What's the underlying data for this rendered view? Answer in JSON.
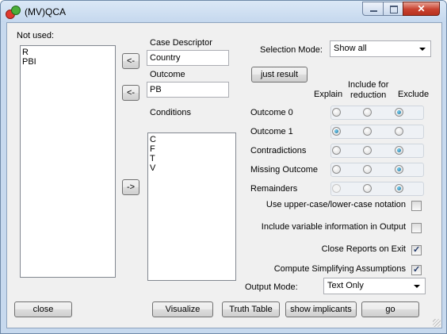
{
  "window": {
    "title": "(MV)QCA",
    "minimize_label": "minimize",
    "maximize_label": "maximize",
    "close_glyph": "✕"
  },
  "not_used": {
    "label": "Not used:",
    "items": [
      "R",
      "PBI"
    ]
  },
  "case_descriptor": {
    "label": "Case Descriptor",
    "value": "Country",
    "move_button": "<-"
  },
  "outcome": {
    "label": "Outcome",
    "value": "PB",
    "move_button": "<-"
  },
  "conditions": {
    "label": "Conditions",
    "items": [
      "C",
      "F",
      "T",
      "V"
    ],
    "move_button": "->"
  },
  "selection_mode": {
    "label": "Selection Mode:",
    "value": "Show all"
  },
  "just_result_button": "just result",
  "columns": {
    "explain": "Explain",
    "include": "Include for\nreduction",
    "exclude": "Exclude"
  },
  "rows": [
    {
      "label": "Outcome 0",
      "selected": "exclude",
      "explain_disabled": false
    },
    {
      "label": "Outcome 1",
      "selected": "explain",
      "explain_disabled": false
    },
    {
      "label": "Contradictions",
      "selected": "exclude",
      "explain_disabled": false
    },
    {
      "label": "Missing Outcome",
      "selected": "exclude",
      "explain_disabled": false
    },
    {
      "label": "Remainders",
      "selected": "exclude",
      "explain_disabled": true
    }
  ],
  "options": [
    {
      "label": "Use upper-case/lower-case notation",
      "checked": false
    },
    {
      "label": "Include variable information in Output",
      "checked": false
    },
    {
      "label": "Close Reports on Exit",
      "checked": true
    },
    {
      "label": "Compute Simplifying Assumptions",
      "checked": true
    }
  ],
  "output_mode": {
    "label": "Output Mode:",
    "value": "Text Only"
  },
  "buttons": {
    "close": "close",
    "visualize": "Visualize",
    "truth_table": "Truth Table",
    "show_implicants": "show implicants",
    "go": "go"
  }
}
